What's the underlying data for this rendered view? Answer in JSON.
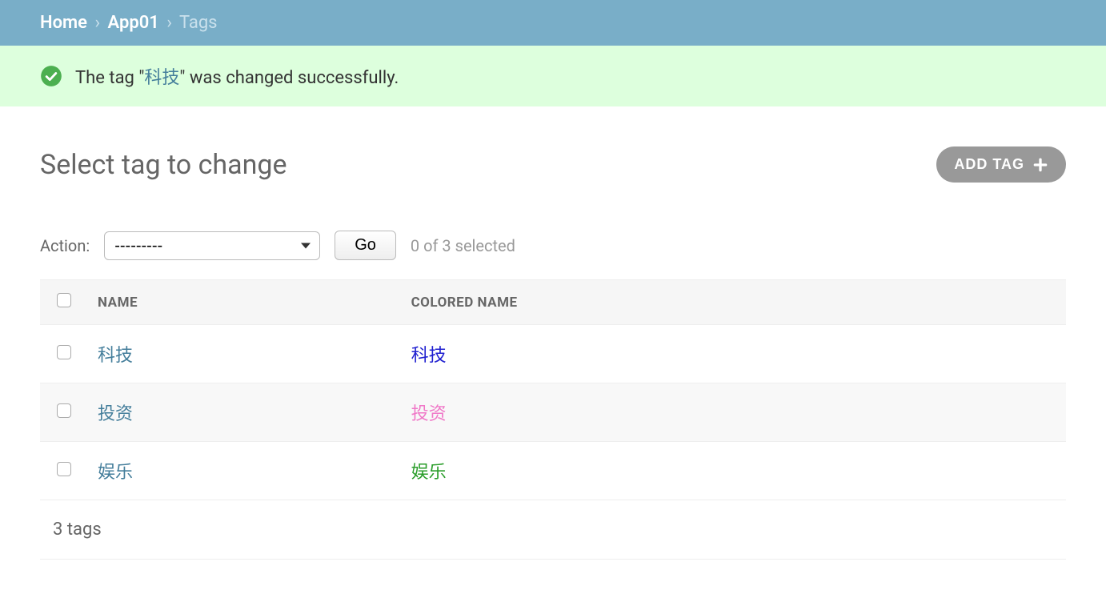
{
  "breadcrumb": {
    "home": "Home",
    "app": "App01",
    "current": "Tags"
  },
  "message": {
    "prefix": "The tag \"",
    "tag": "科技",
    "suffix": "\" was changed successfully."
  },
  "header": {
    "title": "Select tag to change",
    "add_label": "ADD TAG"
  },
  "actions": {
    "label": "Action:",
    "placeholder": "---------",
    "go_label": "Go",
    "selection_text": "0 of 3 selected"
  },
  "table": {
    "columns": {
      "name": "Name",
      "colored_name": "Colored Name"
    },
    "rows": [
      {
        "name": "科技",
        "colored_name": "科技",
        "color": "#2020d0"
      },
      {
        "name": "投资",
        "colored_name": "投资",
        "color": "#f078c8"
      },
      {
        "name": "娱乐",
        "colored_name": "娱乐",
        "color": "#2a9d2a"
      }
    ],
    "footer": "3 tags"
  }
}
